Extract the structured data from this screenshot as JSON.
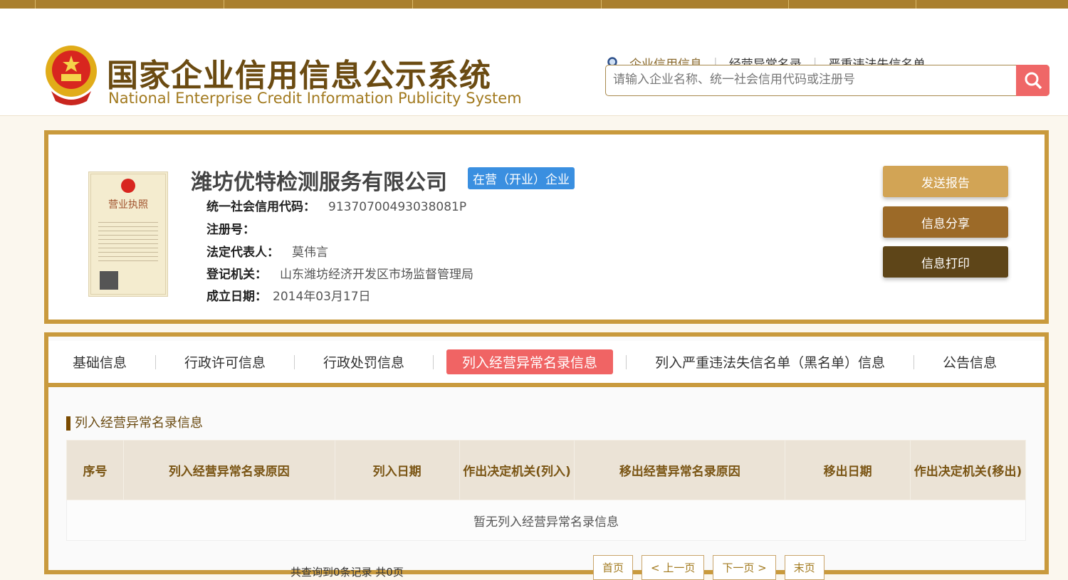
{
  "header": {
    "logo_cn": "国家企业信用信息公示系统",
    "logo_en": "National Enterprise Credit Information Publicity System",
    "nav": [
      {
        "label": "企业信用信息"
      },
      {
        "label": "经营异常名录"
      },
      {
        "label": "严重违法失信名单"
      }
    ],
    "search_placeholder": "请输入企业名称、统一社会信用代码或注册号"
  },
  "company": {
    "name": "潍坊优特检测服务有限公司",
    "status": "在营（开业）企业",
    "fields": [
      {
        "label": "统一社会信用代码：",
        "value": "91370700493038081P"
      },
      {
        "label": "注册号：",
        "value": ""
      },
      {
        "label": "法定代表人：",
        "value": "莫伟言"
      },
      {
        "label": "登记机关：",
        "value": "山东潍坊经济开发区市场监督管理局"
      },
      {
        "label": "成立日期：",
        "value": "2014年03月17日"
      }
    ],
    "license_title": "营业执照"
  },
  "actions": [
    {
      "label": "发送报告",
      "color": "#d2a455"
    },
    {
      "label": "信息分享",
      "color": "#9c6a28"
    },
    {
      "label": "信息打印",
      "color": "#5e4518"
    }
  ],
  "tabs": [
    {
      "label": "基础信息"
    },
    {
      "label": "行政许可信息"
    },
    {
      "label": "行政处罚信息"
    },
    {
      "label": "列入经营异常名录信息",
      "active": true
    },
    {
      "label": "列入严重违法失信名单（黑名单）信息"
    },
    {
      "label": "公告信息"
    }
  ],
  "section": {
    "title": "列入经营异常名录信息",
    "columns": [
      "序号",
      "列入经营异常名录原因",
      "列入日期",
      "作出决定机关(列入)",
      "移出经营异常名录原因",
      "移出日期",
      "作出决定机关(移出)"
    ],
    "empty": "暂无列入经营异常名录信息"
  },
  "pager": {
    "total": "共查询到0条记录 共0页",
    "buttons": [
      "首页",
      "< 上一页",
      "下一页 >",
      "末页"
    ]
  }
}
